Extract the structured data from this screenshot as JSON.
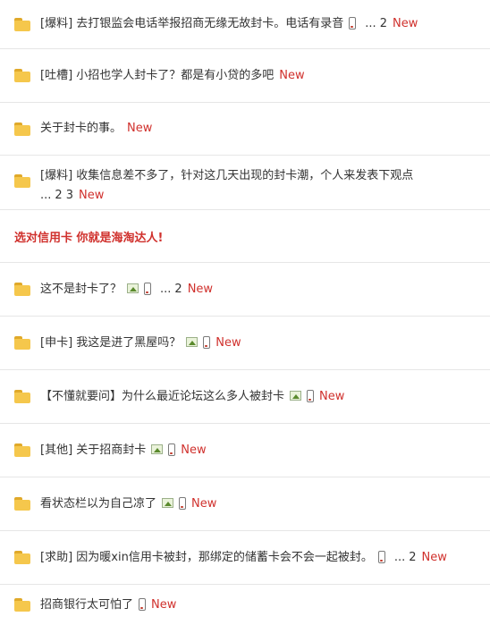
{
  "threads": [
    {
      "title": "[爆料] 去打银监会电话举报招商无缘无故封卡。电话有录音",
      "has_image": false,
      "has_phone": true,
      "pages": [
        "...",
        "2"
      ],
      "new": "New"
    },
    {
      "title": "[吐槽] 小招也学人封卡了？都是有小贷的多吧",
      "has_image": false,
      "has_phone": false,
      "pages": [],
      "new": "New"
    },
    {
      "title": "关于封卡的事。",
      "has_image": false,
      "has_phone": false,
      "pages": [],
      "new": "New"
    },
    {
      "title": "[爆料] 收集信息差不多了，针对这几天出现的封卡潮，个人来发表下观点",
      "has_image": false,
      "has_phone": false,
      "pages": [
        "...",
        "2",
        "3"
      ],
      "new": "New"
    },
    {
      "title": "这不是封卡了？",
      "has_image": true,
      "has_phone": true,
      "pages": [
        "...",
        "2"
      ],
      "new": "New"
    },
    {
      "title": "[申卡] 我这是进了黑屋吗？",
      "has_image": true,
      "has_phone": true,
      "pages": [],
      "new": "New"
    },
    {
      "title": "【不懂就要问】为什么最近论坛这么多人被封卡",
      "has_image": true,
      "has_phone": true,
      "pages": [],
      "new": "New"
    },
    {
      "title": "[其他] 关于招商封卡",
      "has_image": true,
      "has_phone": true,
      "pages": [],
      "new": "New"
    },
    {
      "title": "看状态栏以为自己凉了",
      "has_image": true,
      "has_phone": true,
      "pages": [],
      "new": "New"
    },
    {
      "title": "[求助] 因为暖xin信用卡被封，那绑定的储蓄卡会不会一起被封。",
      "has_image": false,
      "has_phone": true,
      "pages": [
        "...",
        "2"
      ],
      "new": "New"
    },
    {
      "title": "招商银行太可怕了",
      "has_image": false,
      "has_phone": true,
      "pages": [],
      "new": "New"
    }
  ],
  "ad_text": "选对信用卡 你就是海淘达人!",
  "colors": {
    "new": "#d0312d",
    "ad": "#d0312d",
    "folder": "#f5c74c"
  }
}
